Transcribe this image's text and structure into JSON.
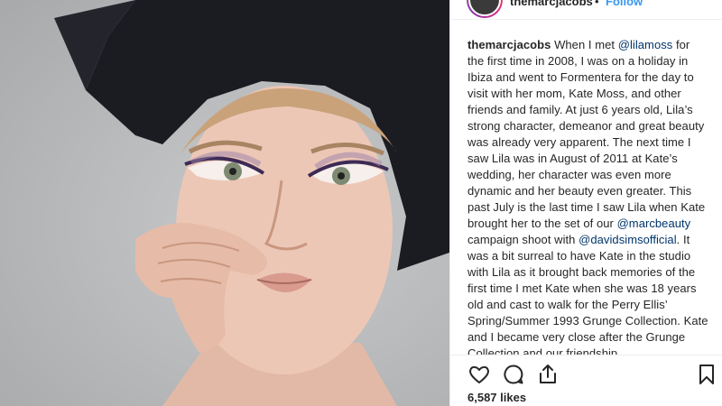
{
  "post": {
    "photo_subject": "portrait-photo",
    "username": "themarcjacobs",
    "follow_label": "Follow",
    "header_separator": "•"
  },
  "caption": {
    "username": "themarcjacobs",
    "text_1": " When I met ",
    "mention_1": "@lilamoss",
    "text_2": " for the first time in 2008, I was on a holiday in Ibiza and went to Formentera for the day to visit with her mom, Kate Moss, and other friends and family. At just 6 years old, Lila’s strong character, demeanor and great beauty was already very apparent. The next time I saw Lila was in August of 2011 at Kate’s wedding, her character was even more dynamic and her beauty even greater. This past July is the last time I saw Lila when Kate brought her to the set of our ",
    "mention_2": "@marcbeauty",
    "text_3": " campaign shoot with ",
    "mention_3": "@davidsimsofficial",
    "text_4": ". It was a bit surreal to have Kate in the studio with Lila as it brought back memories of the first time I met Kate when she was 18 years old and cast to walk for the Perry Ellis’ Spring/Summer 1993 Grunge Collection. Kate and I became very close after the Grunge Collection and our friendship"
  },
  "actions": {
    "like_icon": "heart-icon",
    "comment_icon": "comment-icon",
    "share_icon": "share-icon",
    "save_icon": "bookmark-icon"
  },
  "likes": {
    "label": "6,587 likes"
  },
  "colors": {
    "link": "#003569",
    "follow": "#3897f0",
    "text": "#262626",
    "border": "#efefef"
  }
}
